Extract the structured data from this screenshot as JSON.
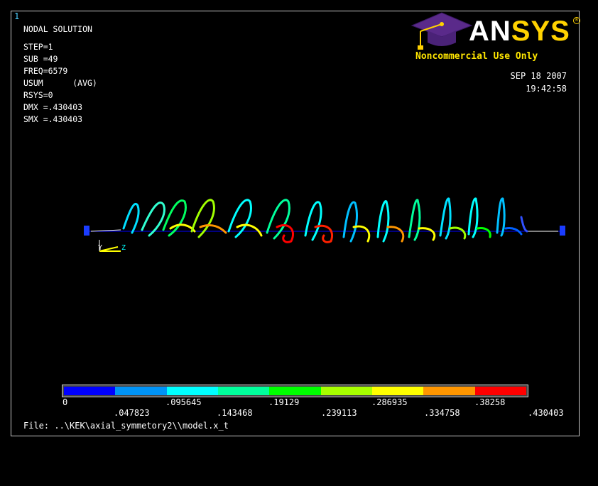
{
  "window_number": "1",
  "info_lines": [
    "NODAL SOLUTION",
    "STEP=1",
    "SUB =49",
    "FREQ=6579",
    "USUM      (AVG)",
    "RSYS=0",
    "DMX =.430403",
    "SMX =.430403"
  ],
  "logo": {
    "part1": "AN",
    "part2": "SYS",
    "trademark": "R"
  },
  "noncommercial": "Noncommercial Use Only",
  "date": "SEP 18 2007",
  "time": "19:42:58",
  "triad": {
    "y": "Y",
    "z": "Z"
  },
  "legend": {
    "colors": [
      "#0000ff",
      "#0093f6",
      "#00ffff",
      "#00ff9c",
      "#00ff00",
      "#a7ff00",
      "#ffff00",
      "#ff9600",
      "#ff0000"
    ],
    "top_labels": [
      "0",
      ".095645",
      ".19129",
      ".286935",
      ".38258"
    ],
    "bottom_labels": [
      ".047823",
      ".143468",
      ".239113",
      ".334758",
      ".430403"
    ]
  },
  "file": "File: ..\\KEK\\axial_symmetory2\\\\model.x_t"
}
